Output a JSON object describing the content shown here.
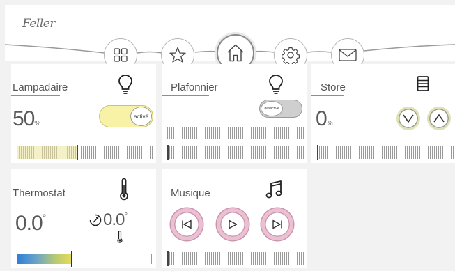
{
  "header": {
    "logo_text": "Feller"
  },
  "nav": [
    {
      "name": "grid-icon",
      "active": false
    },
    {
      "name": "star-icon",
      "active": false
    },
    {
      "name": "home-icon",
      "active": true
    },
    {
      "name": "gear-icon",
      "active": false
    },
    {
      "name": "mail-icon",
      "active": false
    }
  ],
  "cards": {
    "lampadaire": {
      "title": "Lampadaire",
      "value": "50",
      "unit": "%",
      "toggle_label": "activé",
      "level": 0.44
    },
    "plafonnier": {
      "title": "Plafonnier",
      "toggle_label": "désactivé"
    },
    "store": {
      "title": "Store",
      "value": "0",
      "unit": "%"
    },
    "thermostat": {
      "title": "Thermostat",
      "value": "0.0",
      "unit": "°",
      "setpoint": "0.0",
      "setpoint_unit": "°"
    },
    "musique": {
      "title": "Musique"
    }
  },
  "colors": {
    "toggle_on": "#f7f2a6",
    "store_btn_ring": "#dfe2b8",
    "music_btn_ring": "#ecbfd3"
  }
}
